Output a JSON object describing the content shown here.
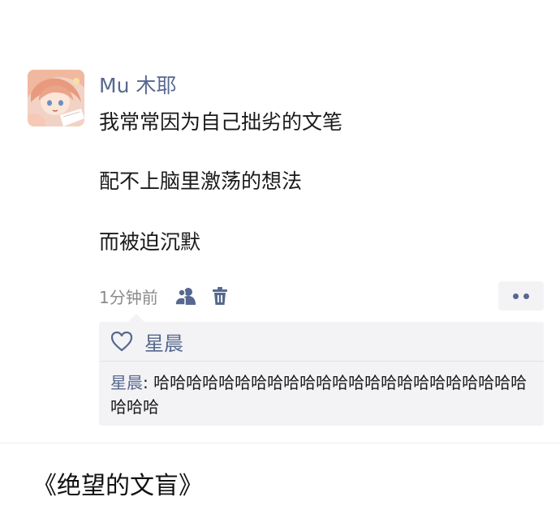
{
  "post": {
    "username": "Mu 木耶",
    "lines": [
      "我常常因为自己拙劣的文笔",
      "配不上脑里激荡的想法",
      "而被迫沉默"
    ],
    "timestamp": "1分钟前",
    "icons": {
      "avatar": "anime-girl-avatar",
      "visibility": "people-icon",
      "delete": "trash-icon",
      "more": "more-dots-icon"
    }
  },
  "reactions": {
    "likes": [
      "星晨"
    ],
    "like_icon": "heart-icon",
    "comments": [
      {
        "author": "星晨",
        "text": "哈哈哈哈哈哈哈哈哈哈哈哈哈哈哈哈哈哈哈哈哈哈哈哈哈哈"
      }
    ]
  },
  "caption": "《绝望的文盲》",
  "colors": {
    "name_link": "#56688f",
    "text": "#1a1a1a",
    "meta": "#8b8b8b",
    "panel": "#f3f3f5"
  }
}
